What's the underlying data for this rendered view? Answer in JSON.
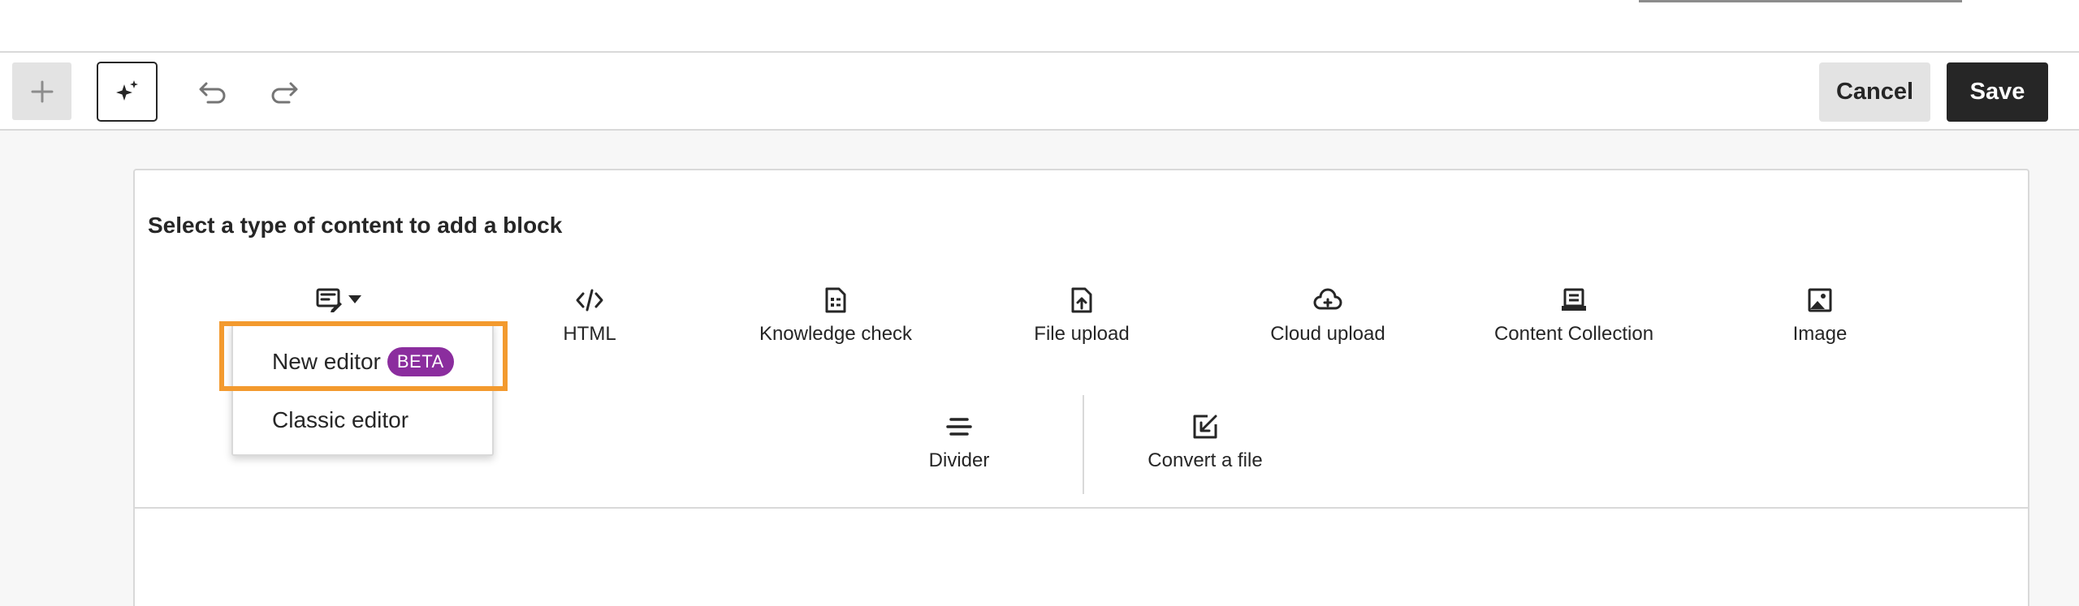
{
  "toolbar": {
    "add_icon": "plus-icon",
    "ai_icon": "sparkle-icon",
    "undo_icon": "undo-icon",
    "redo_icon": "redo-icon",
    "cancel_label": "Cancel",
    "save_label": "Save"
  },
  "panel": {
    "title": "Select a type of content to add a block",
    "blocks": [
      {
        "label": "HTML",
        "icon": "code-icon"
      },
      {
        "label": "Knowledge check",
        "icon": "knowledge-check-icon"
      },
      {
        "label": "File upload",
        "icon": "file-upload-icon"
      },
      {
        "label": "Cloud upload",
        "icon": "cloud-upload-icon"
      },
      {
        "label": "Content Collection",
        "icon": "content-collection-icon"
      },
      {
        "label": "Image",
        "icon": "image-icon"
      },
      {
        "label": "Divider",
        "icon": "divider-icon"
      },
      {
        "label": "Convert a file",
        "icon": "convert-file-icon"
      }
    ]
  },
  "text_editor_menu": {
    "trigger_icon": "text-editor-icon",
    "items": [
      {
        "label": "New editor",
        "badge": "BETA"
      },
      {
        "label": "Classic editor"
      }
    ]
  },
  "colors": {
    "accent_dark": "#262626",
    "beta_badge": "#8b2d9e",
    "highlight": "#f39a2e"
  }
}
